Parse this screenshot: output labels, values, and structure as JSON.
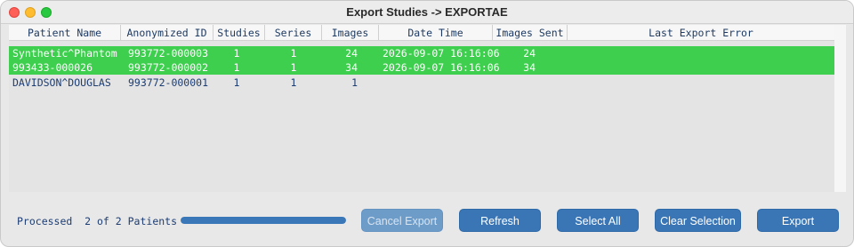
{
  "window": {
    "title": "Export Studies -> EXPORTAE"
  },
  "table": {
    "headers": [
      "Patient Name",
      "Anonymized ID",
      "Studies",
      "Series",
      "Images",
      "Date Time",
      "Images Sent",
      "Last Export Error"
    ],
    "rows": [
      {
        "selected": true,
        "patient_name": "Synthetic^Phantom",
        "anon_id": "993772-000003",
        "studies": "1",
        "series": "1",
        "images": "24",
        "date_time": "2026-09-07 16:16:06",
        "images_sent": "24",
        "error": ""
      },
      {
        "selected": true,
        "patient_name": "993433-000026",
        "anon_id": "993772-000002",
        "studies": "1",
        "series": "1",
        "images": "34",
        "date_time": "2026-09-07 16:16:06",
        "images_sent": "34",
        "error": ""
      },
      {
        "selected": false,
        "patient_name": "DAVIDSON^DOUGLAS",
        "anon_id": "993772-000001",
        "studies": "1",
        "series": "1",
        "images": "1",
        "date_time": "",
        "images_sent": "",
        "error": ""
      }
    ]
  },
  "footer": {
    "status": "Processed  2 of 2 Patients",
    "progress": 1.0,
    "buttons": {
      "cancel_export": "Cancel Export",
      "refresh": "Refresh",
      "select_all": "Select All",
      "clear_selection": "Clear Selection",
      "export": "Export"
    }
  },
  "colors": {
    "selected_row": "#3ecf4e",
    "button": "#3a76b6",
    "text": "#1d3d73"
  }
}
